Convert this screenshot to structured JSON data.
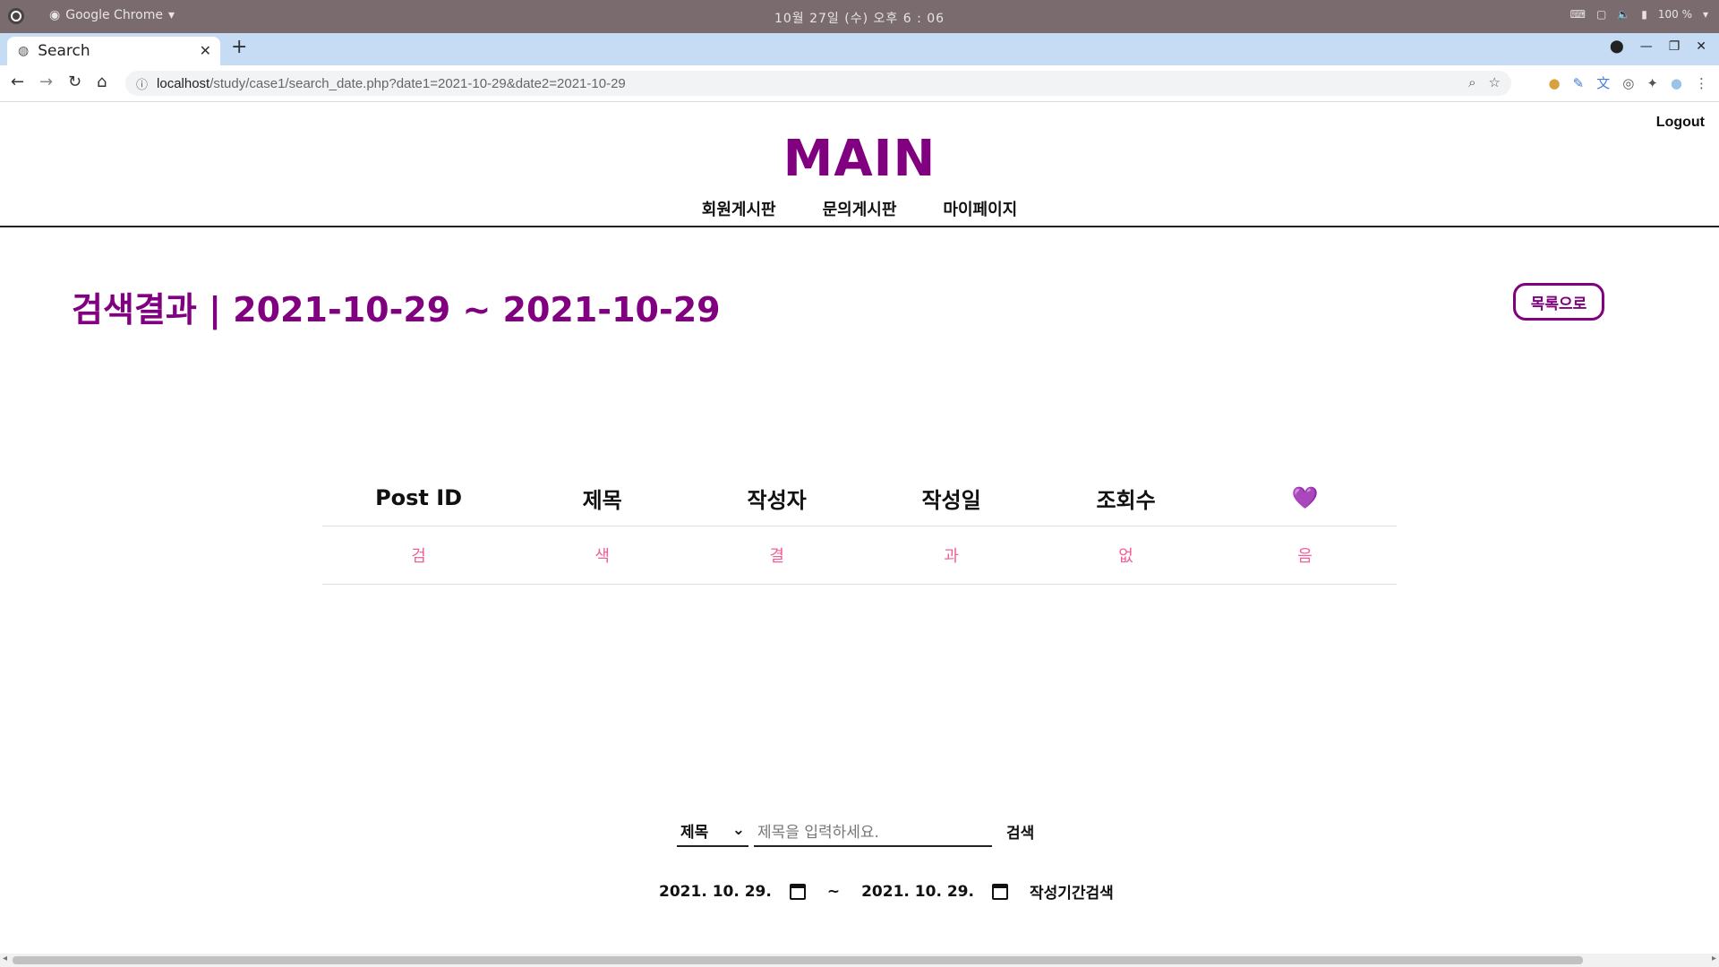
{
  "os": {
    "app_name": "Google Chrome",
    "clock": "10월 27일 (수) 오후 6 : 06",
    "battery": "100 %"
  },
  "browser": {
    "tab_title": "Search",
    "url_host": "localhost",
    "url_path": "/study/case1/search_date.php?date1=2021-10-29&date2=2021-10-29"
  },
  "header": {
    "logout": "Logout",
    "brand": "MAIN",
    "menu": [
      "회원게시판",
      "문의게시판",
      "마이페이지"
    ]
  },
  "main": {
    "heading": "검색결과 | 2021-10-29 ~ 2021-10-29",
    "back_button": "목록으로",
    "table": {
      "headers": [
        "Post ID",
        "제목",
        "작성자",
        "작성일",
        "조회수",
        "💜"
      ],
      "row": [
        "검",
        "색",
        "결",
        "과",
        "없",
        "음"
      ]
    },
    "search": {
      "select_value": "제목",
      "placeholder": "제목을 입력하세요.",
      "button": "검색"
    },
    "date_search": {
      "date1": "2021. 10. 29.",
      "separator": "~",
      "date2": "2021. 10. 29.",
      "button": "작성기간검색"
    }
  }
}
